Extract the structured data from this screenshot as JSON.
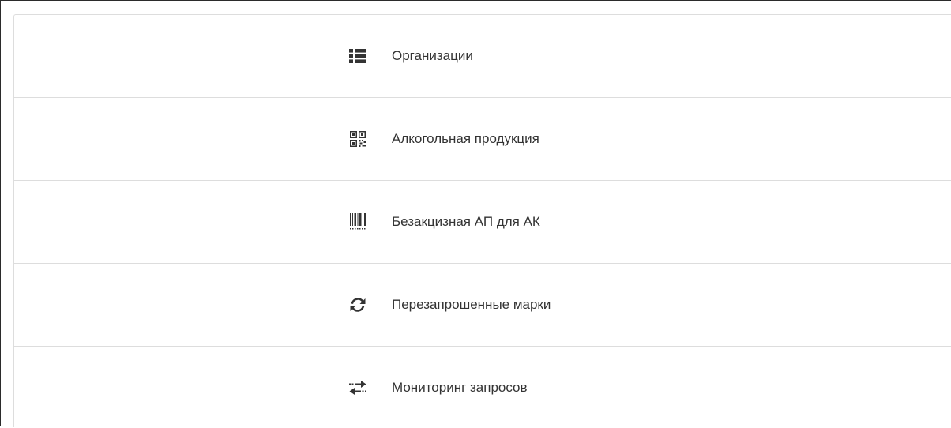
{
  "menu": {
    "items": [
      {
        "label": "Организации",
        "icon": "list-icon"
      },
      {
        "label": "Алкогольная продукция",
        "icon": "qrcode-icon"
      },
      {
        "label": "Безакцизная АП для АК",
        "icon": "barcode-icon"
      },
      {
        "label": "Перезапрошенные марки",
        "icon": "refresh-icon"
      },
      {
        "label": "Мониторинг запросов",
        "icon": "transfer-icon"
      }
    ]
  },
  "colors": {
    "text": "#333333",
    "divider": "#dddddd",
    "icon": "#333333"
  }
}
